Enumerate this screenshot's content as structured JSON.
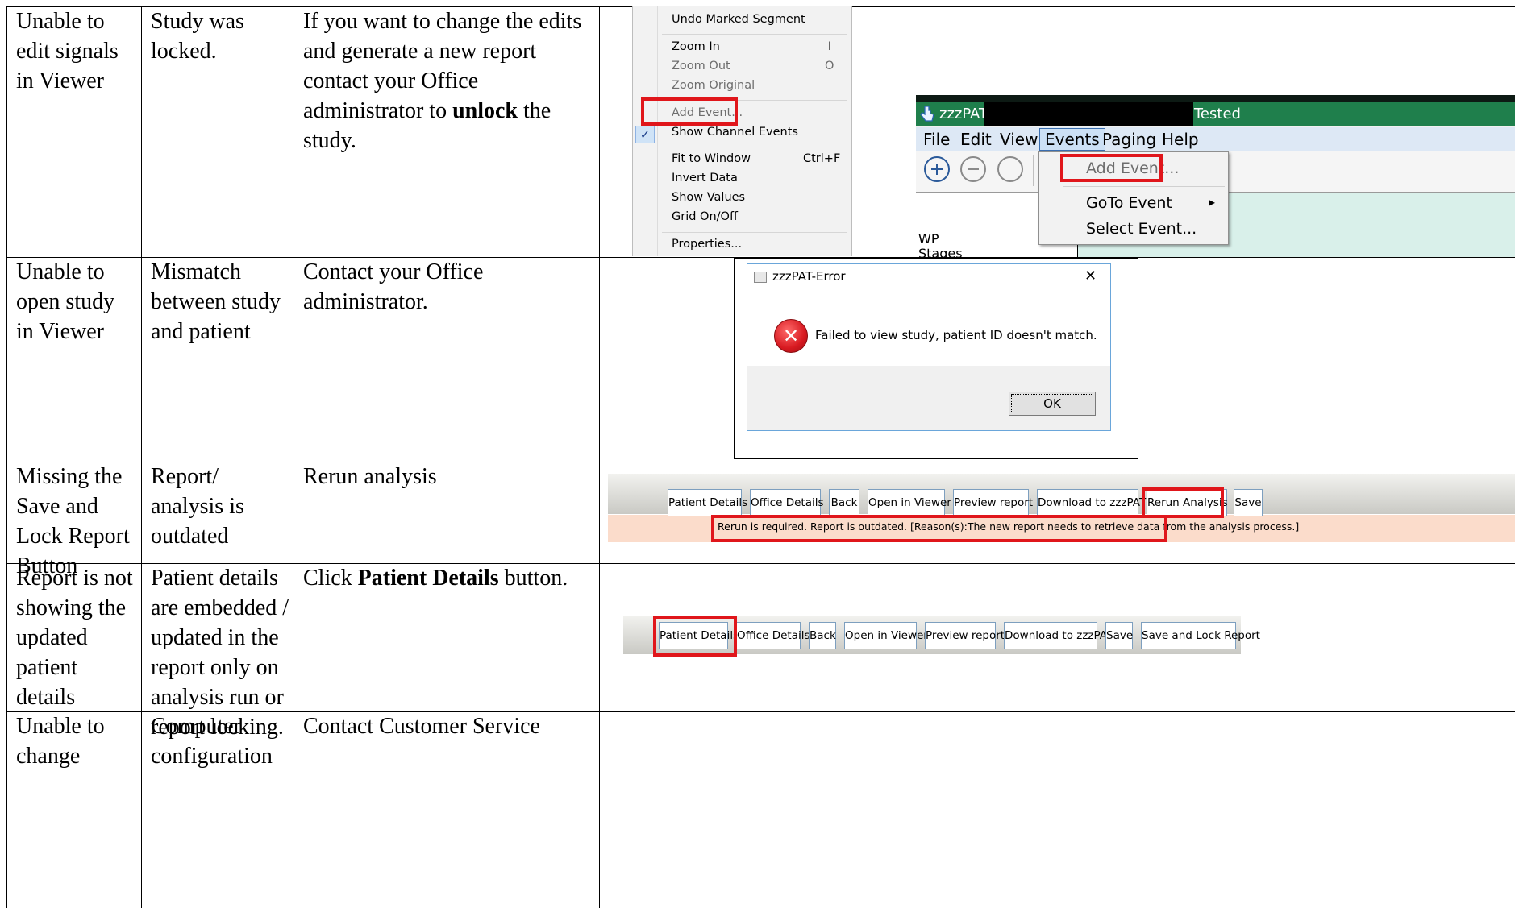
{
  "table": {
    "rows": [
      {
        "issue": "Unable to\nedit signals\nin Viewer",
        "cause": "Study was\nlocked.",
        "resolution": {
          "before": "If you want to change the edits\nand generate a new report\ncontact your Office\nadministrator to ",
          "bold": "unlock",
          "after": " the\nstudy."
        }
      },
      {
        "issue": "Unable to\nopen study\nin Viewer",
        "cause": "Mismatch\nbetween study\nand patient",
        "resolution": {
          "before": "Contact your Office\nadministrator.",
          "bold": "",
          "after": ""
        }
      },
      {
        "issue": "Missing the\nSave and\nLock Report\nButton",
        "cause": "Report/\nanalysis is\noutdated",
        "resolution": {
          "before": "Rerun analysis",
          "bold": "",
          "after": ""
        }
      },
      {
        "issue": "Report is not\nshowing the\nupdated\npatient\ndetails",
        "cause": "Patient details\nare embedded /\nupdated in the\nreport only on\nanalysis run or\nreport locking.",
        "resolution": {
          "before": "Click ",
          "bold": "Patient Details",
          "after": " button."
        }
      },
      {
        "issue": "Unable to\nchange",
        "cause": "Computer\nconfiguration",
        "resolution": {
          "before": "Contact Customer Service",
          "bold": "",
          "after": ""
        }
      }
    ]
  },
  "context_menu": {
    "items": [
      {
        "label": "Undo Marked Segment",
        "shortcut": ""
      },
      {
        "label": "Zoom In",
        "shortcut": "I"
      },
      {
        "label": "Zoom Out",
        "shortcut": "O"
      },
      {
        "label": "Zoom Original",
        "shortcut": ""
      },
      {
        "label": "Add Event...",
        "shortcut": ""
      },
      {
        "label": "Show Channel Events",
        "shortcut": ""
      },
      {
        "label": "Fit to Window",
        "shortcut": "Ctrl+F"
      },
      {
        "label": "Invert Data",
        "shortcut": ""
      },
      {
        "label": "Show Values",
        "shortcut": ""
      },
      {
        "label": "Grid On/Off",
        "shortcut": ""
      },
      {
        "label": "Properties...",
        "shortcut": ""
      }
    ],
    "checkmark": "✓"
  },
  "viewer_window": {
    "title": "zzzPAT",
    "status": "Tested",
    "menubar": [
      "File",
      "Edit",
      "View",
      "Events",
      "Paging",
      "Help"
    ],
    "events_menu": [
      "Add Event...",
      "GoTo Event",
      "Select Event..."
    ],
    "submenu_arrow": "▸",
    "channel_label": "WP",
    "channel_label_2": "Stages"
  },
  "error_dialog": {
    "title": "zzzPAT-Error",
    "close_glyph": "✕",
    "message": "Failed to view study, patient ID doesn't match.",
    "ok_label": "OK",
    "error_glyph": "✕"
  },
  "toolbar_rerun": {
    "buttons": [
      "Patient Details",
      "Office Details",
      "Back",
      "Open in Viewer",
      "Preview report",
      "Download to zzzPAT",
      "Rerun Analysis",
      "Save"
    ],
    "warning": "Rerun is required. Report is outdated. [Reason(s):The new report needs to retrieve data from the analysis process.]"
  },
  "toolbar_patient": {
    "buttons": [
      "Patient Details",
      "Office Details",
      "Back",
      "Open in Viewer",
      "Preview report",
      "Download to zzzPAT",
      "Save",
      "Save and Lock Report"
    ]
  },
  "colors": {
    "highlight_red": "#e0161b",
    "warning_bg": "#fbdccb",
    "button_border": "#7d9fbf",
    "viewer_green": "#1f7f4c"
  }
}
